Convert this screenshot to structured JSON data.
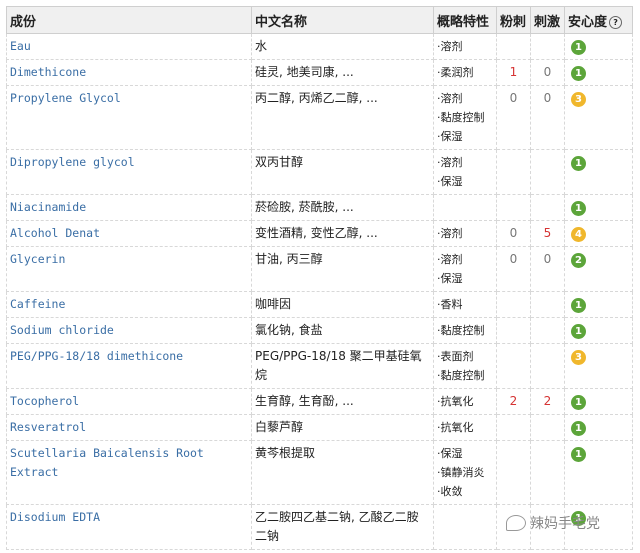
{
  "headers": {
    "ingredient": "成份",
    "chinese": "中文名称",
    "property": "概略特性",
    "acne": "粉刺",
    "irritation": "刺激",
    "safety": "安心度",
    "help": "?"
  },
  "rows": [
    {
      "en": "Eau",
      "cn": "水",
      "props": [
        "·溶剂"
      ],
      "acne": "",
      "irr": "",
      "safety": "1",
      "safety_color": "#5ca53a"
    },
    {
      "en": "Dimethicone",
      "cn": "硅灵, 地美司康, ...",
      "props": [
        "·柔润剂"
      ],
      "acne": "1",
      "irr": "0",
      "safety": "1",
      "safety_color": "#5ca53a"
    },
    {
      "en": "Propylene Glycol",
      "cn": "丙二醇, 丙烯乙二醇, ...",
      "props": [
        "·溶剂",
        "·黏度控制",
        "·保湿"
      ],
      "acne": "0",
      "irr": "0",
      "safety": "3",
      "safety_color": "#f0b72c"
    },
    {
      "en": "Dipropylene glycol",
      "cn": "双丙甘醇",
      "props": [
        "·溶剂",
        "·保湿"
      ],
      "acne": "",
      "irr": "",
      "safety": "1",
      "safety_color": "#5ca53a"
    },
    {
      "en": "Niacinamide",
      "cn": "菸硷胺, 菸酰胺, ...",
      "props": [],
      "acne": "",
      "irr": "",
      "safety": "1",
      "safety_color": "#5ca53a"
    },
    {
      "en": "Alcohol Denat",
      "cn": "变性酒精, 变性乙醇, ...",
      "props": [
        "·溶剂"
      ],
      "acne": "0",
      "irr": "5",
      "safety": "4",
      "safety_color": "#f0b72c"
    },
    {
      "en": "Glycerin",
      "cn": "甘油, 丙三醇",
      "props": [
        "·溶剂",
        "·保湿"
      ],
      "acne": "0",
      "irr": "0",
      "safety": "2",
      "safety_color": "#5ca53a"
    },
    {
      "en": "Caffeine",
      "cn": "咖啡因",
      "props": [
        "·香料"
      ],
      "acne": "",
      "irr": "",
      "safety": "1",
      "safety_color": "#5ca53a"
    },
    {
      "en": "Sodium chloride",
      "cn": "氯化钠, 食盐",
      "props": [
        "·黏度控制"
      ],
      "acne": "",
      "irr": "",
      "safety": "1",
      "safety_color": "#5ca53a"
    },
    {
      "en": "PEG/PPG-18/18 dimethicone",
      "cn": "PEG/PPG-18/18 聚二甲基硅氧烷",
      "props": [
        "·表面剂",
        "·黏度控制"
      ],
      "acne": "",
      "irr": "",
      "safety": "3",
      "safety_color": "#f0b72c"
    },
    {
      "en": "Tocopherol",
      "cn": "生育醇, 生育酚, ...",
      "props": [
        "·抗氧化"
      ],
      "acne": "2",
      "irr": "2",
      "safety": "1",
      "safety_color": "#5ca53a"
    },
    {
      "en": "Resveratrol",
      "cn": "白藜芦醇",
      "props": [
        "·抗氧化"
      ],
      "acne": "",
      "irr": "",
      "safety": "1",
      "safety_color": "#5ca53a"
    },
    {
      "en": "Scutellaria Baicalensis Root Extract",
      "cn": "黄芩根提取",
      "props": [
        "·保湿",
        "·镇静消炎",
        "·收敛"
      ],
      "acne": "",
      "irr": "",
      "safety": "1",
      "safety_color": "#5ca53a"
    },
    {
      "en": "Disodium EDTA",
      "cn": "乙二胺四乙基二钠, 乙酸乙二胺二钠",
      "props": [],
      "acne": "",
      "irr": "",
      "safety": "1",
      "safety_color": "#5ca53a"
    }
  ],
  "watermark": "辣妈手毛党"
}
